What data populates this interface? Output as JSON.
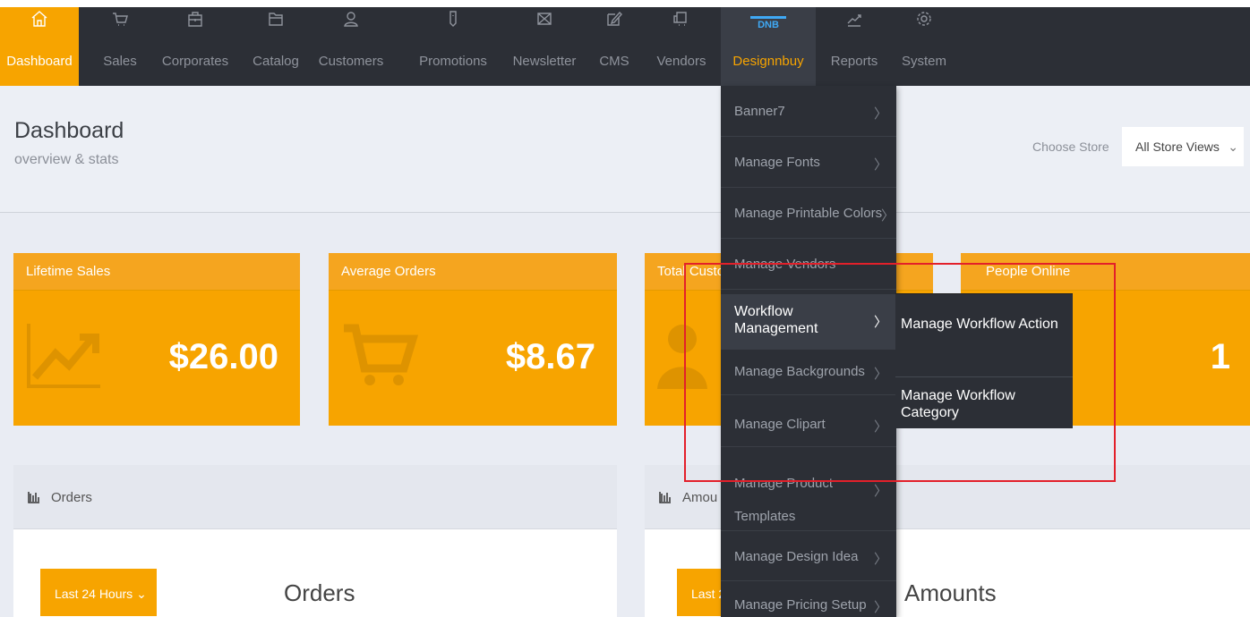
{
  "nav": {
    "items": [
      {
        "label": "Dashboard",
        "icon": "home-icon"
      },
      {
        "label": "Sales",
        "icon": "cart-icon"
      },
      {
        "label": "Corporates",
        "icon": "briefcase-icon"
      },
      {
        "label": "Catalog",
        "icon": "folder-icon"
      },
      {
        "label": "Customers",
        "icon": "user-icon"
      },
      {
        "label": "Promotions",
        "icon": "tag-icon"
      },
      {
        "label": "Newsletter",
        "icon": "mail-icon"
      },
      {
        "label": "CMS",
        "icon": "edit-icon"
      },
      {
        "label": "Vendors",
        "icon": "truck-icon"
      },
      {
        "label": "Designnbuy",
        "icon": "dnb-logo-icon",
        "badge": "DNB"
      },
      {
        "label": "Reports",
        "icon": "chart-line-icon"
      },
      {
        "label": "System",
        "icon": "gear-icon"
      }
    ]
  },
  "header": {
    "title": "Dashboard",
    "subtitle": "overview & stats",
    "choose_store_label": "Choose Store",
    "store_value": "All Store Views"
  },
  "cards": [
    {
      "title": "Lifetime Sales",
      "value": "$26.00"
    },
    {
      "title": "Average Orders",
      "value": "$8.67"
    },
    {
      "title": "Total Custo",
      "value": ""
    },
    {
      "title": "People Online",
      "value": "1"
    }
  ],
  "panels": {
    "orders": {
      "header": "Orders",
      "button": "Last 24 Hours",
      "title": "Orders"
    },
    "amounts": {
      "header": "Amou",
      "button": "Last 2",
      "title": "Amounts"
    }
  },
  "menu": {
    "items": [
      {
        "label": "Banner7"
      },
      {
        "label": "Manage Fonts"
      },
      {
        "label": "Manage Printable Colors"
      },
      {
        "label": "Manage Vendors"
      },
      {
        "label": "Workflow Management"
      },
      {
        "label": "Manage Backgrounds"
      },
      {
        "label": "Manage Clipart"
      },
      {
        "label": "Manage Product Templates"
      },
      {
        "label": "Manage Design Idea"
      },
      {
        "label": "Manage Pricing Setup"
      }
    ]
  },
  "submenu": {
    "items": [
      {
        "label": "Manage Workflow Action"
      },
      {
        "label": "Manage Workflow Category"
      }
    ]
  },
  "colors": {
    "accent": "#f7a400",
    "nav_bg": "#2c2f36",
    "highlight_box": "#e3202a"
  }
}
